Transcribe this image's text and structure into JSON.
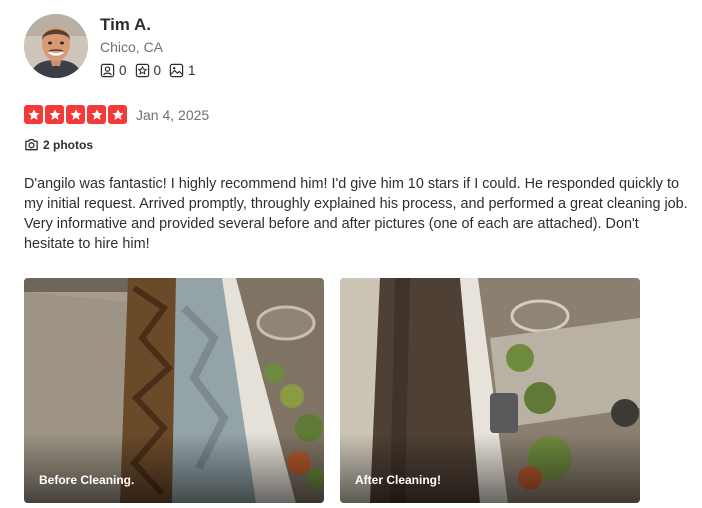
{
  "user": {
    "name": "Tim A.",
    "location": "Chico, CA",
    "stats": {
      "friends": "0",
      "reviews": "0",
      "photos": "1"
    }
  },
  "review": {
    "rating": 5,
    "date": "Jan 4, 2025",
    "photo_count_label": "2 photos",
    "text": "D'angilo was fantastic! I highly recommend him! I'd give him 10 stars if I could. He responded quickly to my initial request. Arrived promptly, throughly explained his process, and performed a great cleaning job. Very informative and provided several before and after pictures (one of each are attached). Don't hesitate to hire him!"
  },
  "photos": [
    {
      "caption": "Before Cleaning."
    },
    {
      "caption": "After Cleaning!"
    }
  ],
  "colors": {
    "star": "#f43939",
    "text": "#2d2e2f",
    "muted": "#6e7072"
  },
  "icons": [
    "friends-icon",
    "reviews-icon",
    "photos-icon",
    "star-icon",
    "camera-icon"
  ]
}
